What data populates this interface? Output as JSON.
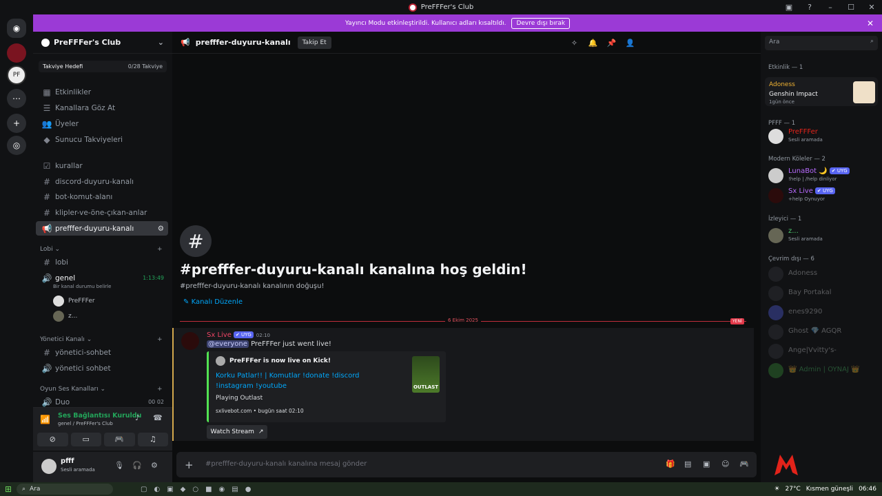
{
  "window": {
    "title": "PreFFFer's Club"
  },
  "banner": {
    "text": "Yayıncı Modu etkinleştirildi. Kullanıcı adları kısaltıldı.",
    "button": "Devre dışı bırak"
  },
  "server": {
    "name": "PreFFFer's Club",
    "boost_label": "Takviye Hedefi",
    "boost_count": "0/28 Takviye"
  },
  "nav": [
    {
      "icon": "calendar-icon",
      "label": "Etkinlikler"
    },
    {
      "icon": "browse-icon",
      "label": "Kanallara Göz At"
    },
    {
      "icon": "members-icon",
      "label": "Üyeler"
    },
    {
      "icon": "boost-icon",
      "label": "Sunucu Takviyeleri"
    }
  ],
  "channels": [
    "kurallar",
    "discord-duyuru-kanalı",
    "bot-komut-alanı",
    "klipler-ve-öne-çıkan-anlar",
    "prefffer-duyuru-kanalı"
  ],
  "lobi": {
    "category": "Lobi",
    "channel": "lobi",
    "voice": "genel",
    "voice_time": "1:13:49",
    "voice_status": "Bir kanal durumu belirle",
    "users": [
      "PreFFFer",
      "z..."
    ]
  },
  "yonetici": {
    "category": "Yönetici Kanalı",
    "channels": [
      "yönetici-sohbet",
      "yönetici sohbet"
    ]
  },
  "oyun": {
    "category": "Oyun Ses Kanalları",
    "channel": "Duo",
    "c1": "00",
    "c2": "02"
  },
  "voice_panel": {
    "status": "Ses Bağlantısı Kuruldu",
    "location": "genel / PreFFFer's Club"
  },
  "user": {
    "name": "pfff",
    "status": "Sesli aramada"
  },
  "header": {
    "channel": "prefffer-duyuru-kanalı",
    "follow": "Takip Et",
    "search": "Ara"
  },
  "welcome": {
    "title": "#prefffer-duyuru-kanalı kanalına hoş geldin!",
    "sub": "#prefffer-duyuru-kanalı kanalının doğuşu!",
    "edit": "Kanalı Düzenle"
  },
  "divider": {
    "date": "6 Ekim 2025",
    "new": "YENİ"
  },
  "message": {
    "author": "Sx Live",
    "badge": "UYG",
    "time": "02:10",
    "mention": "@everyone",
    "text": "PreFFFer just went live!",
    "embed": {
      "author": "PreFFFer is now live on Kick!",
      "title": "Korku Patlar!! | Komutlar !donate !discord !instagram !youtube",
      "desc": "Playing Outlast",
      "footer": "sxlivebot.com • bugün saat 02:10",
      "thumb": "OUTLAST"
    },
    "button": "Watch Stream"
  },
  "composer": {
    "placeholder": "#prefffer-duyuru-kanalı kanalına mesaj gönder"
  },
  "members": {
    "activity_cat": "Etkinlik — 1",
    "activity": {
      "name": "Adoness",
      "game": "Genshin Impact",
      "when": "1gün önce"
    },
    "pfff_cat": "PFFF — 1",
    "pfff": {
      "name": "PreFFFer",
      "sub": "Sesli aramada"
    },
    "mod_cat": "Modern Köleler — 2",
    "mods": [
      {
        "name": "LunaBot 🌙",
        "badge": "UYG",
        "sub": "!help | /help dinliyor"
      },
      {
        "name": "Sx Live",
        "badge": "UYG",
        "sub": "+help Oynuyor"
      }
    ],
    "viewer_cat": "İzleyici — 1",
    "viewer": {
      "name": "z...",
      "sub": "Sesli aramada"
    },
    "offline_cat": "Çevrim dışı — 6",
    "offline": [
      "Adoness",
      "Bay Portakal",
      "enes9290",
      "Ghost 💎 AGQR",
      "Ange|Vvitty's-",
      "👑 Admin | OYNAJ 👑"
    ]
  },
  "taskbar": {
    "search": "Ara",
    "weather": "27°C",
    "weather_desc": "Kısmen güneşli",
    "time": "06:46"
  }
}
